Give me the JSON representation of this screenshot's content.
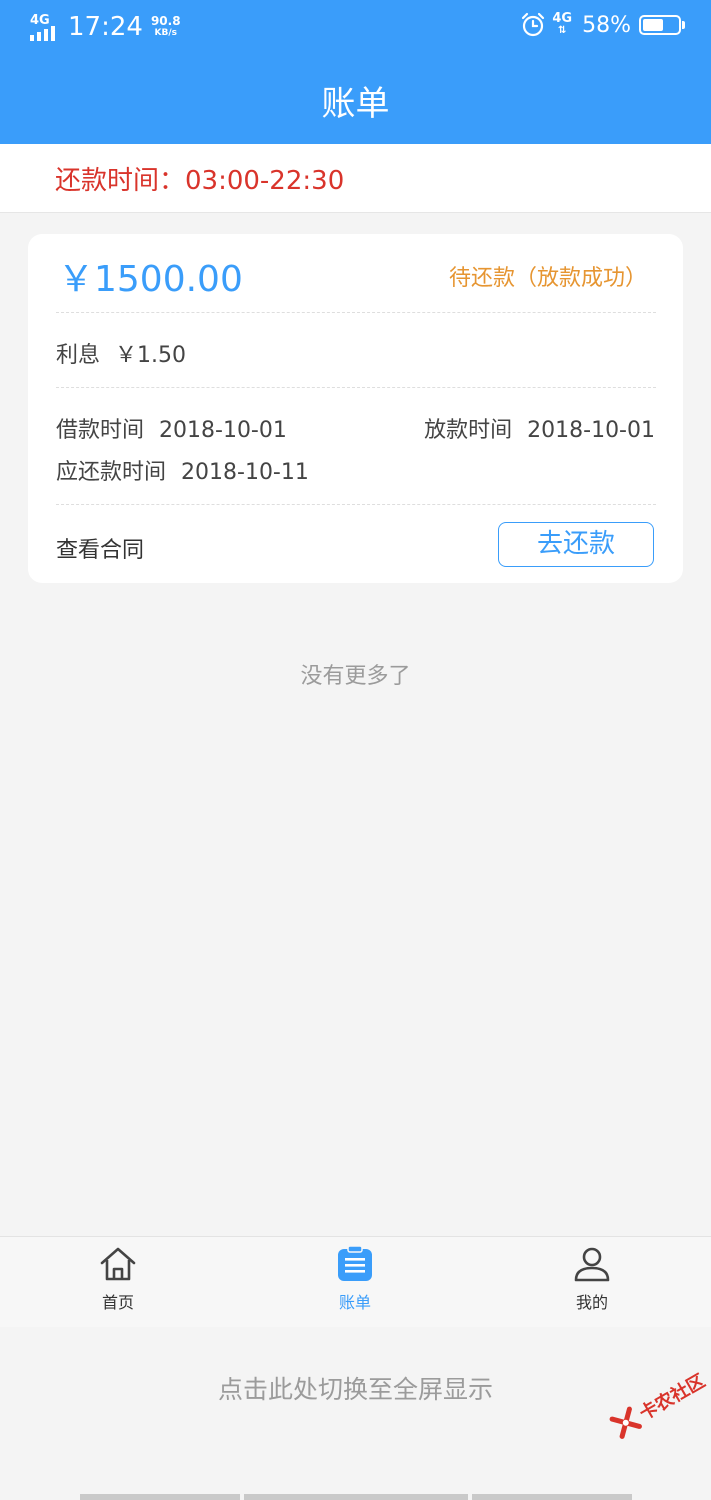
{
  "status_bar": {
    "network": "4G",
    "time": "17:24",
    "speed_value": "90.8",
    "speed_unit": "KB/s",
    "network_right": "4G",
    "battery_percent": "58%",
    "battery_level": 0.58
  },
  "header": {
    "title": "账单"
  },
  "repay_time": {
    "text": "还款时间：03:00-22:30"
  },
  "bill": {
    "amount": "￥1500.00",
    "status": "待还款（放款成功）",
    "interest_label": "利息",
    "interest_value": "￥1.50",
    "borrow_label": "借款时间",
    "borrow_date": "2018-10-01",
    "loan_label": "放款时间",
    "loan_date": "2018-10-01",
    "due_label": "应还款时间",
    "due_date": "2018-10-11",
    "view_contract": "查看合同",
    "repay_button": "去还款"
  },
  "list_footer": "没有更多了",
  "bottom_nav": {
    "items": [
      {
        "label": "首页",
        "icon": "home-icon"
      },
      {
        "label": "账单",
        "icon": "bill-icon",
        "active": true
      },
      {
        "label": "我的",
        "icon": "user-icon"
      }
    ]
  },
  "fullscreen_tip": "点击此处切换至全屏显示",
  "watermark": "卡农社区",
  "colors": {
    "primary": "#3a9dfa",
    "warning": "#e69531",
    "danger": "#d9342b",
    "background": "#f4f4f4"
  }
}
